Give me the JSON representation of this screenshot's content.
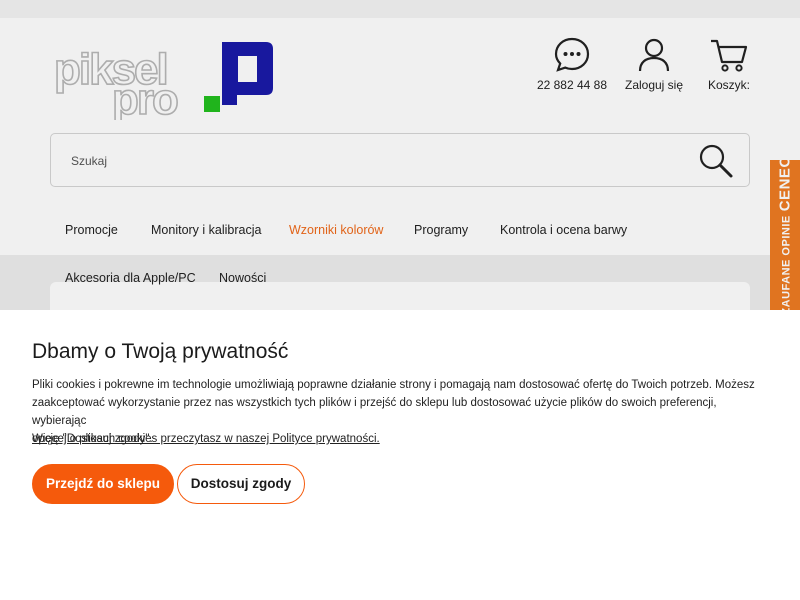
{
  "header": {
    "logo_alt": "piksel pro",
    "contact": {
      "icon": "chat-bubble-icon",
      "label": "22 882 44 88"
    },
    "login": {
      "icon": "user-icon",
      "label": "Zaloguj się"
    },
    "cart": {
      "icon": "cart-icon",
      "label": "Koszyk:"
    }
  },
  "search": {
    "placeholder": "Szukaj",
    "icon": "magnifier-icon"
  },
  "nav": {
    "items": [
      {
        "label": "Promocje"
      },
      {
        "label": "Monitory i kalibracja"
      },
      {
        "label": "Wzorniki kolorów",
        "active": true
      },
      {
        "label": "Programy"
      },
      {
        "label": "Kontrola i ocena barwy"
      },
      {
        "label": "Akcesoria dla Apple/PC"
      },
      {
        "label": "Nowości"
      }
    ]
  },
  "ceneo": {
    "text": "ZAUFANE OPINIE",
    "brand": "CENEO"
  },
  "cookie": {
    "title": "Dbamy o Twoją prywatność",
    "line1": "Pliki cookies i pokrewne im technologie umożliwiają poprawne działanie strony i pomagają nam dostosować ofertę do Twoich potrzeb. Możesz",
    "line2": "zaakceptować wykorzystanie przez nas wszystkich tych plików i przejść do sklepu lub dostosować użycie plików do swoich preferencji, wybierając",
    "line3": "opcję \"Dostosuj zgody\".",
    "link": "Więcej o plikach cookies przeczytasz w naszej Polityce prywatności.",
    "accept_label": "Przejdź do sklepu",
    "customize_label": "Dostosuj zgody"
  },
  "colors": {
    "accent": "#f55a0c",
    "nav_active": "#f06a1a",
    "ceneo": "#ef7c22",
    "logo_blue": "#1a1aa8",
    "logo_green": "#22c01e"
  }
}
